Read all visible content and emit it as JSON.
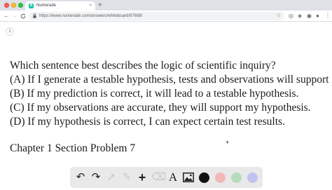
{
  "browser": {
    "tab_title": "Numerade",
    "tab_close": "×",
    "new_tab": "+",
    "favicon_letter": "N",
    "url": "https://www.numerade.com/answers/whiteboard/97698/",
    "nav": {
      "back": "←",
      "forward": "→",
      "reload": "C"
    },
    "bookmark_icon": "star-icon",
    "menu": "⋮"
  },
  "page": {
    "page_number": "1",
    "question_lines": [
      "Which sentence best describes the logic of scientific inquiry?",
      "(A) If I generate a testable hypothesis, tests and observations will support it.",
      "(B) If my prediction is correct, it will lead to a testable hypothesis.",
      "(C) If my observations are accurate, they will support my hypothesis.",
      "(D) If my hypothesis is correct, I can expect certain test results."
    ],
    "section_label": "Chapter 1 Section Problem 7",
    "cursor_mark": "+"
  },
  "drawing_toolbar": {
    "tools": [
      {
        "name": "undo-icon",
        "glyph": "↶",
        "enabled": true
      },
      {
        "name": "redo-icon",
        "glyph": "↷",
        "enabled": true
      },
      {
        "name": "select-arrow-icon",
        "glyph": "➚",
        "enabled": false
      },
      {
        "name": "pen-icon",
        "glyph": "✎",
        "enabled": false
      },
      {
        "name": "add-icon",
        "glyph": "+",
        "enabled": true
      },
      {
        "name": "eraser-icon",
        "glyph": "⌫",
        "enabled": false
      },
      {
        "name": "text-tool-icon",
        "glyph": "A",
        "enabled": true
      },
      {
        "name": "image-icon",
        "glyph": "▣",
        "enabled": true
      }
    ],
    "colors": [
      "#111111",
      "#f2b8b5",
      "#b7dbb8",
      "#c1c3ef"
    ]
  }
}
